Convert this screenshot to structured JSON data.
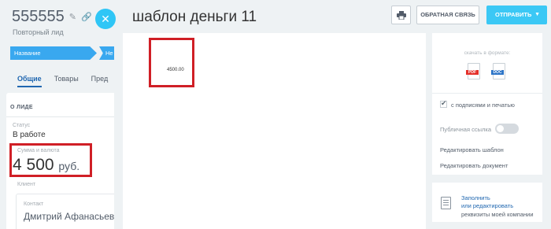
{
  "crm": {
    "deal_title": "555555",
    "deal_subtitle": "Повторный лид",
    "stages": [
      "Название",
      "Не с"
    ],
    "tabs": [
      "Общие",
      "Товары",
      "Пред"
    ],
    "section_title": "О ЛИДЕ",
    "status_label": "Статус",
    "status_value": "В работе",
    "amount_label": "Сумма и валюта",
    "amount_value": "4 500",
    "amount_currency": "руб.",
    "client_label": "Клиент",
    "contact_label": "Контакт",
    "contact_name": "Дмитрий Афанасьев"
  },
  "panel": {
    "title": "шаблон деньги 11",
    "feedback_button": "ОБРАТНАЯ СВЯЗЬ",
    "send_button": "ОТПРАВИТЬ",
    "document_amount": "4500.00",
    "download_label": "скачать в формате:",
    "format_pdf": "PDF",
    "format_doc": "DOC",
    "signatures_label": "с подписями и печатью",
    "signatures_checked": true,
    "public_link_label": "Публичная ссылка",
    "public_link_enabled": false,
    "edit_template": "Редактировать шаблон",
    "edit_document": "Редактировать документ",
    "company_link_1": "Заполнить",
    "company_link_2": "или редактировать",
    "company_text": "реквизиты моей компании"
  },
  "colors": {
    "accent": "#3bc8f5",
    "highlight_frame": "#d01f26",
    "link": "#2067b0"
  }
}
